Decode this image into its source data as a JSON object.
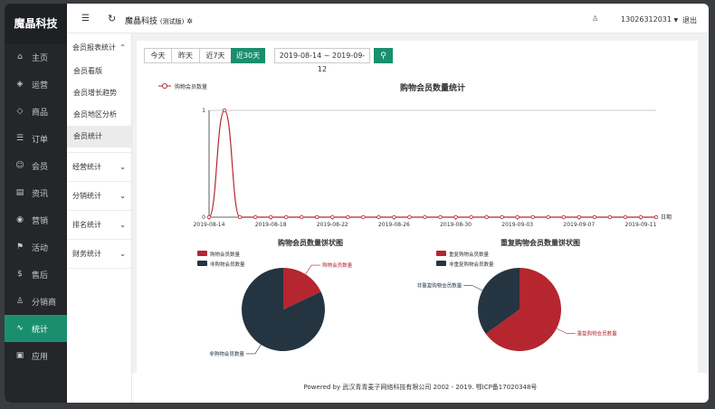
{
  "app": {
    "name": "魔晶科技",
    "title": "魔晶科技",
    "edition": "(测试版)"
  },
  "header": {
    "phone": "13026312031",
    "logout": "退出"
  },
  "nav": [
    {
      "label": "主页",
      "icon": "home-icon"
    },
    {
      "label": "运营",
      "icon": "shield-icon"
    },
    {
      "label": "商品",
      "icon": "tag-icon"
    },
    {
      "label": "订单",
      "icon": "list-icon"
    },
    {
      "label": "会员",
      "icon": "user-icon"
    },
    {
      "label": "资讯",
      "icon": "news-icon"
    },
    {
      "label": "营销",
      "icon": "coin-icon"
    },
    {
      "label": "活动",
      "icon": "flag-icon"
    },
    {
      "label": "售后",
      "icon": "dollar-icon"
    },
    {
      "label": "分销商",
      "icon": "person-icon"
    },
    {
      "label": "统计",
      "icon": "pulse-icon",
      "active": true
    },
    {
      "label": "应用",
      "icon": "app-icon"
    }
  ],
  "subnav": {
    "group1": "会员报表统计",
    "items": [
      "会员看版",
      "会员增长趋势",
      "会员地区分析",
      "会员统计"
    ],
    "groups": [
      "经营统计",
      "分销统计",
      "排名统计",
      "财务统计"
    ]
  },
  "filters": {
    "today": "今天",
    "yesterday": "昨天",
    "last7": "近7天",
    "last30": "近30天",
    "date_range": "2019-08-14 ~ 2019-09-12"
  },
  "footer": "Powered by 武汉青青麦子网络科技有限公司 2002 - 2019. 鄂ICP备17020348号",
  "chart_data": [
    {
      "type": "line",
      "title": "购物会员数量统计",
      "series": [
        {
          "name": "购物会员数量",
          "values": [
            0,
            1,
            0,
            0,
            0,
            0,
            0,
            0,
            0,
            0,
            0,
            0,
            0,
            0,
            0,
            0,
            0,
            0,
            0,
            0,
            0,
            0,
            0,
            0,
            0,
            0,
            0,
            0,
            0,
            0
          ]
        }
      ],
      "x": [
        "2019-08-14",
        "2019-08-15",
        "2019-08-16",
        "2019-08-17",
        "2019-08-18",
        "2019-08-19",
        "2019-08-20",
        "2019-08-21",
        "2019-08-22",
        "2019-08-23",
        "2019-08-24",
        "2019-08-25",
        "2019-08-26",
        "2019-08-27",
        "2019-08-28",
        "2019-08-29",
        "2019-08-30",
        "2019-08-31",
        "2019-09-01",
        "2019-09-02",
        "2019-09-03",
        "2019-09-04",
        "2019-09-05",
        "2019-09-06",
        "2019-09-07",
        "2019-09-08",
        "2019-09-09",
        "2019-09-10",
        "2019-09-11",
        "2019-09-12"
      ],
      "xtick_labels": [
        "2019-08-14",
        "2019-08-18",
        "2019-08-22",
        "2019-08-26",
        "2019-08-30",
        "2019-09-03",
        "2019-09-07",
        "2019-09-11"
      ],
      "xlabel": "日期",
      "ylim": [
        0,
        1
      ],
      "yticks": [
        "0",
        "1"
      ],
      "color": "#b5262f"
    },
    {
      "type": "pie",
      "title": "购物会员数量饼状图",
      "slices": [
        {
          "name": "购物会员数量",
          "value": 18,
          "color": "#b5262f"
        },
        {
          "name": "非购物会员数量",
          "value": 82,
          "color": "#253441"
        }
      ],
      "legend": [
        "购物会员数量",
        "非购物会员数量"
      ]
    },
    {
      "type": "pie",
      "title": "重复购物会员数量饼状图",
      "slices": [
        {
          "name": "重复购物会员数量",
          "value": 65,
          "color": "#b5262f"
        },
        {
          "name": "非重复购物会员数量",
          "value": 35,
          "color": "#253441"
        }
      ],
      "legend": [
        "重复购物会员数量",
        "非重复购物会员数量"
      ]
    }
  ]
}
